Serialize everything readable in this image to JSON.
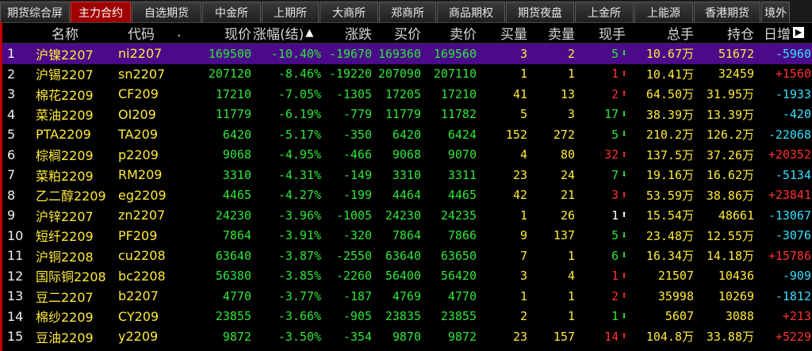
{
  "tabs": [
    {
      "label": "期货综合屏",
      "active": false
    },
    {
      "label": "主力合约",
      "active": true
    },
    {
      "label": "自选期货",
      "active": false
    },
    {
      "label": "中金所",
      "active": false
    },
    {
      "label": "上期所",
      "active": false
    },
    {
      "label": "大商所",
      "active": false
    },
    {
      "label": "郑商所",
      "active": false
    },
    {
      "label": "商品期权",
      "active": false
    },
    {
      "label": "期货夜盘",
      "active": false
    },
    {
      "label": "上金所",
      "active": false
    },
    {
      "label": "上能源",
      "active": false
    },
    {
      "label": "香港期货",
      "active": false
    },
    {
      "label": "境外",
      "active": false
    }
  ],
  "header": {
    "name": "名称",
    "code": "代码",
    "dot": ".",
    "price": "现价",
    "pct": "涨幅(结)",
    "change": "涨跌",
    "bid": "买价",
    "ask": "卖价",
    "bidvol": "买量",
    "askvol": "卖量",
    "cur": "现手",
    "total": "总手",
    "oi": "持仓",
    "daily": "日增"
  },
  "sort_icon": "▲",
  "pin_icon": "▶",
  "rows": [
    {
      "no": "1",
      "name": "沪镍2207",
      "code": "ni2207",
      "price": "169500",
      "pct": "-10.40%",
      "change": "-19670",
      "bid": "169360",
      "ask": "169560",
      "bidvol": "3",
      "askvol": "2",
      "cur": "5",
      "dir": "down",
      "total": "10.67万",
      "oi": "51672",
      "daily": "-5960"
    },
    {
      "no": "2",
      "name": "沪锡2207",
      "code": "sn2207",
      "price": "207120",
      "pct": "-8.46%",
      "change": "-19220",
      "bid": "207090",
      "ask": "207110",
      "bidvol": "1",
      "askvol": "1",
      "cur": "1",
      "dir": "up",
      "total": "10.41万",
      "oi": "32459",
      "daily": "+1560"
    },
    {
      "no": "3",
      "name": "棉花2209",
      "code": "CF209",
      "price": "17210",
      "pct": "-7.05%",
      "change": "-1305",
      "bid": "17205",
      "ask": "17210",
      "bidvol": "41",
      "askvol": "13",
      "cur": "2",
      "dir": "up",
      "total": "64.50万",
      "oi": "31.95万",
      "daily": "-1933"
    },
    {
      "no": "4",
      "name": "菜油2209",
      "code": "OI209",
      "price": "11779",
      "pct": "-6.19%",
      "change": "-779",
      "bid": "11779",
      "ask": "11782",
      "bidvol": "5",
      "askvol": "3",
      "cur": "17",
      "dir": "down",
      "total": "38.39万",
      "oi": "13.39万",
      "daily": "-420"
    },
    {
      "no": "5",
      "name": "PTA2209",
      "code": "TA209",
      "price": "6420",
      "pct": "-5.17%",
      "change": "-350",
      "bid": "6420",
      "ask": "6424",
      "bidvol": "152",
      "askvol": "272",
      "cur": "5",
      "dir": "down",
      "total": "210.2万",
      "oi": "126.2万",
      "daily": "-22068"
    },
    {
      "no": "6",
      "name": "棕榈2209",
      "code": "p2209",
      "price": "9068",
      "pct": "-4.95%",
      "change": "-466",
      "bid": "9068",
      "ask": "9070",
      "bidvol": "4",
      "askvol": "80",
      "cur": "32",
      "dir": "up",
      "total": "137.5万",
      "oi": "37.26万",
      "daily": "+20352"
    },
    {
      "no": "7",
      "name": "菜粕2209",
      "code": "RM209",
      "price": "3310",
      "pct": "-4.31%",
      "change": "-149",
      "bid": "3310",
      "ask": "3311",
      "bidvol": "23",
      "askvol": "24",
      "cur": "7",
      "dir": "down",
      "total": "19.16万",
      "oi": "16.62万",
      "daily": "-5134"
    },
    {
      "no": "8",
      "name": "乙二醇2209",
      "code": "eg2209",
      "price": "4465",
      "pct": "-4.27%",
      "change": "-199",
      "bid": "4464",
      "ask": "4465",
      "bidvol": "42",
      "askvol": "21",
      "cur": "3",
      "dir": "up",
      "total": "53.59万",
      "oi": "38.86万",
      "daily": "+23841"
    },
    {
      "no": "9",
      "name": "沪锌2207",
      "code": "zn2207",
      "price": "24230",
      "pct": "-3.96%",
      "change": "-1005",
      "bid": "24230",
      "ask": "24235",
      "bidvol": "1",
      "askvol": "26",
      "cur": "1",
      "dir": "upwhite",
      "total": "15.54万",
      "oi": "48661",
      "daily": "-13067"
    },
    {
      "no": "10",
      "name": "短纤2209",
      "code": "PF209",
      "price": "7864",
      "pct": "-3.91%",
      "change": "-320",
      "bid": "7864",
      "ask": "7866",
      "bidvol": "9",
      "askvol": "137",
      "cur": "5",
      "dir": "down",
      "total": "23.48万",
      "oi": "12.55万",
      "daily": "-3076"
    },
    {
      "no": "11",
      "name": "沪铜2208",
      "code": "cu2208",
      "price": "63640",
      "pct": "-3.87%",
      "change": "-2550",
      "bid": "63640",
      "ask": "63650",
      "bidvol": "7",
      "askvol": "1",
      "cur": "6",
      "dir": "down",
      "total": "16.34万",
      "oi": "14.18万",
      "daily": "+15786"
    },
    {
      "no": "12",
      "name": "国际铜2208",
      "code": "bc2208",
      "price": "56380",
      "pct": "-3.85%",
      "change": "-2260",
      "bid": "56400",
      "ask": "56420",
      "bidvol": "3",
      "askvol": "4",
      "cur": "1",
      "dir": "up",
      "total": "21507",
      "oi": "10436",
      "daily": "-909"
    },
    {
      "no": "13",
      "name": "豆二2207",
      "code": "b2207",
      "price": "4770",
      "pct": "-3.77%",
      "change": "-187",
      "bid": "4769",
      "ask": "4770",
      "bidvol": "1",
      "askvol": "1",
      "cur": "2",
      "dir": "up",
      "total": "35998",
      "oi": "10269",
      "daily": "-1812"
    },
    {
      "no": "14",
      "name": "棉纱2209",
      "code": "CY209",
      "price": "23855",
      "pct": "-3.66%",
      "change": "-905",
      "bid": "23835",
      "ask": "23855",
      "bidvol": "2",
      "askvol": "1",
      "cur": "1",
      "dir": "down",
      "total": "5607",
      "oi": "3088",
      "daily": "+213"
    },
    {
      "no": "15",
      "name": "豆油2209",
      "code": "y2209",
      "price": "9872",
      "pct": "-3.50%",
      "change": "-354",
      "bid": "9870",
      "ask": "9872",
      "bidvol": "23",
      "askvol": "157",
      "cur": "14",
      "dir": "up",
      "total": "104.8万",
      "oi": "33.88万",
      "daily": "+5229"
    }
  ],
  "colors": {
    "up": "#ff3030",
    "down": "#2fe63a",
    "selected_row": "#4a0a8a",
    "active_tab": "#a00000",
    "name": "#ffea3b"
  }
}
